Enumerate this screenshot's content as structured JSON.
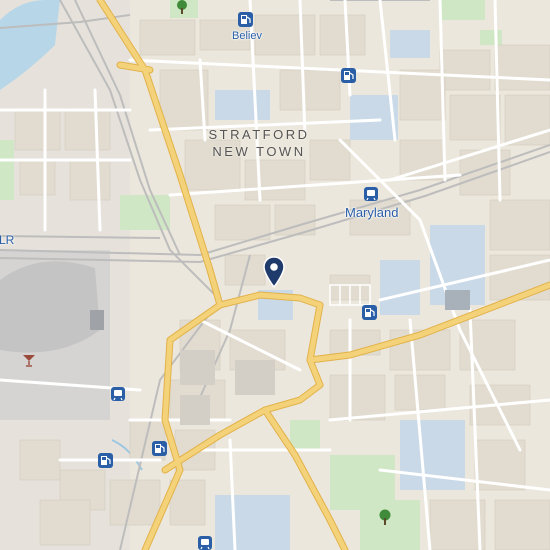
{
  "map": {
    "area_label": {
      "line1": "STRATFORD",
      "line2": "NEW TOWN"
    },
    "station_labels": {
      "maryland": "Maryland",
      "believ": "Believ",
      "dlr_partial": "LR"
    },
    "icons": {
      "location_pin": "location-pin-icon",
      "fuel_station": "fuel-station-icon",
      "rail_station": "rail-station-icon",
      "park_tree": "tree-icon",
      "bar": "cocktail-bar-icon"
    },
    "colors": {
      "land": "#ece7dc",
      "block": "#e1dccf",
      "main_road": "#f3d27a",
      "main_road_casing": "#e2b24a",
      "minor_road": "#ffffff",
      "rail": "#b8b8b8",
      "park": "#cfe7c4",
      "water": "#b7d7e8",
      "building": "#c9d9e8",
      "label_blue": "#2a5fa8",
      "pin": "#1f3b6b"
    }
  }
}
